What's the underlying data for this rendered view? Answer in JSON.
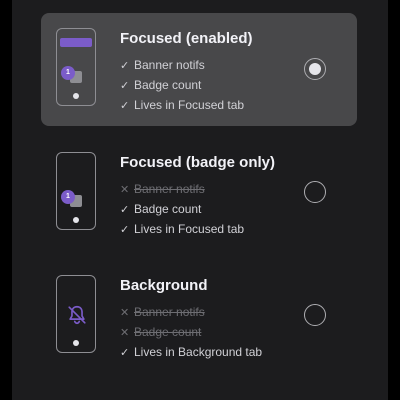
{
  "colors": {
    "accent": "#7b5cc9",
    "panel_background": "#1c1c1e",
    "selected_background": "#48484a",
    "text_primary": "#f2f2f7",
    "text_disabled": "#6d6d72"
  },
  "options": [
    {
      "title": "Focused (enabled)",
      "selected": true,
      "badge_count": "1",
      "features": [
        {
          "label": "Banner notifs",
          "enabled": true,
          "mark": "✓"
        },
        {
          "label": "Badge count",
          "enabled": true,
          "mark": "✓"
        },
        {
          "label": "Lives in Focused tab",
          "enabled": true,
          "mark": "✓"
        }
      ]
    },
    {
      "title": "Focused (badge only)",
      "selected": false,
      "badge_count": "1",
      "features": [
        {
          "label": "Banner notifs",
          "enabled": false,
          "mark": "✕"
        },
        {
          "label": "Badge count",
          "enabled": true,
          "mark": "✓"
        },
        {
          "label": "Lives in Focused tab",
          "enabled": true,
          "mark": "✓"
        }
      ]
    },
    {
      "title": "Background",
      "selected": false,
      "icon": "bell-slash-icon",
      "features": [
        {
          "label": "Banner notifs",
          "enabled": false,
          "mark": "✕"
        },
        {
          "label": "Badge count",
          "enabled": false,
          "mark": "✕"
        },
        {
          "label": "Lives in Background tab",
          "enabled": true,
          "mark": "✓"
        }
      ]
    }
  ]
}
